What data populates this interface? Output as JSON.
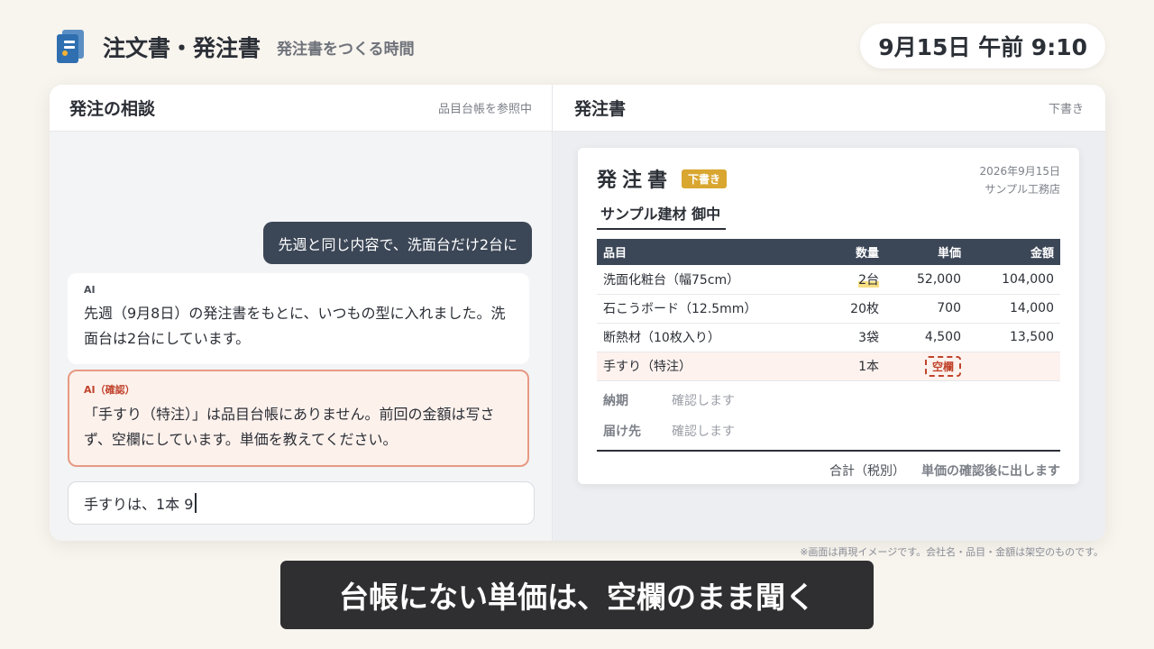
{
  "app": {
    "title": "注文書・発注書",
    "subtitle": "発注書をつくる時間",
    "clock": "9月15日 午前 9:10"
  },
  "chat": {
    "title": "発注の相談",
    "status": "品目台帳を参照中",
    "user_message": "先週と同じ内容で、洗面台だけ2台に",
    "ai_label": "AI",
    "ai_message": "先週（9月8日）の発注書をもとに、いつもの型に入れました。洗面台は2台にしています。",
    "confirm_label": "AI（確認）",
    "confirm_message": "「手すり（特注）」は品目台帳にありません。前回の金額は写さず、空欄にしています。単価を教えてください。",
    "input_value": "手すりは、1本 9"
  },
  "doc_panel": {
    "title": "発注書",
    "status": "下書き"
  },
  "document": {
    "title": "発注書",
    "badge": "下書き",
    "date": "2026年9月15日",
    "issuer": "サンプル工務店",
    "recipient": "サンプル建材 御中",
    "columns": [
      "品目",
      "数量",
      "単価",
      "金額"
    ],
    "rows": [
      {
        "item": "洗面化粧台（幅75cm）",
        "qty": "2台",
        "price": "52,000",
        "amount": "104,000"
      },
      {
        "item": "石こうボード（12.5mm）",
        "qty": "20枚",
        "price": "700",
        "amount": "14,000"
      },
      {
        "item": "断熱材（10枚入り）",
        "qty": "3袋",
        "price": "4,500",
        "amount": "13,500"
      },
      {
        "item": "手すり（特注）",
        "qty": "1本",
        "price": "空欄",
        "amount": ""
      }
    ],
    "delivery_label": "納期",
    "delivery_value": "確認します",
    "destination_label": "届け先",
    "destination_value": "確認します",
    "total_label": "合計（税別）",
    "total_value": "単価の確認後に出します"
  },
  "disclaimer": "※画面は再現イメージです。会社名・品目・金額は架空のものです。",
  "caption": "台帳にない単価は、空欄のまま聞く",
  "colors": {
    "background": "#f8f4ee",
    "accent_dark": "#3b4656",
    "warning": "#c0432b",
    "badge": "#d9a630"
  }
}
